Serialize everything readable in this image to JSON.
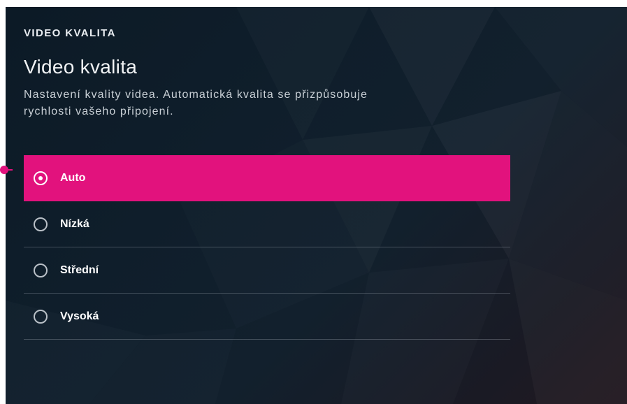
{
  "header": {
    "section_label": "VIDEO KVALITA",
    "title": "Video kvalita",
    "description": "Nastavení kvality videa. Automatická kvalita se přizpůsobuje rychlosti vašeho připojení."
  },
  "options": [
    {
      "label": "Auto",
      "selected": true
    },
    {
      "label": "Nízká",
      "selected": false
    },
    {
      "label": "Střední",
      "selected": false
    },
    {
      "label": "Vysoká",
      "selected": false
    }
  ],
  "colors": {
    "accent": "#e2127d",
    "background": "#0f1e2b",
    "text": "#ffffff"
  },
  "icons": {
    "radio_selected": "radio-checked-icon",
    "radio_unselected": "radio-unchecked-icon"
  }
}
